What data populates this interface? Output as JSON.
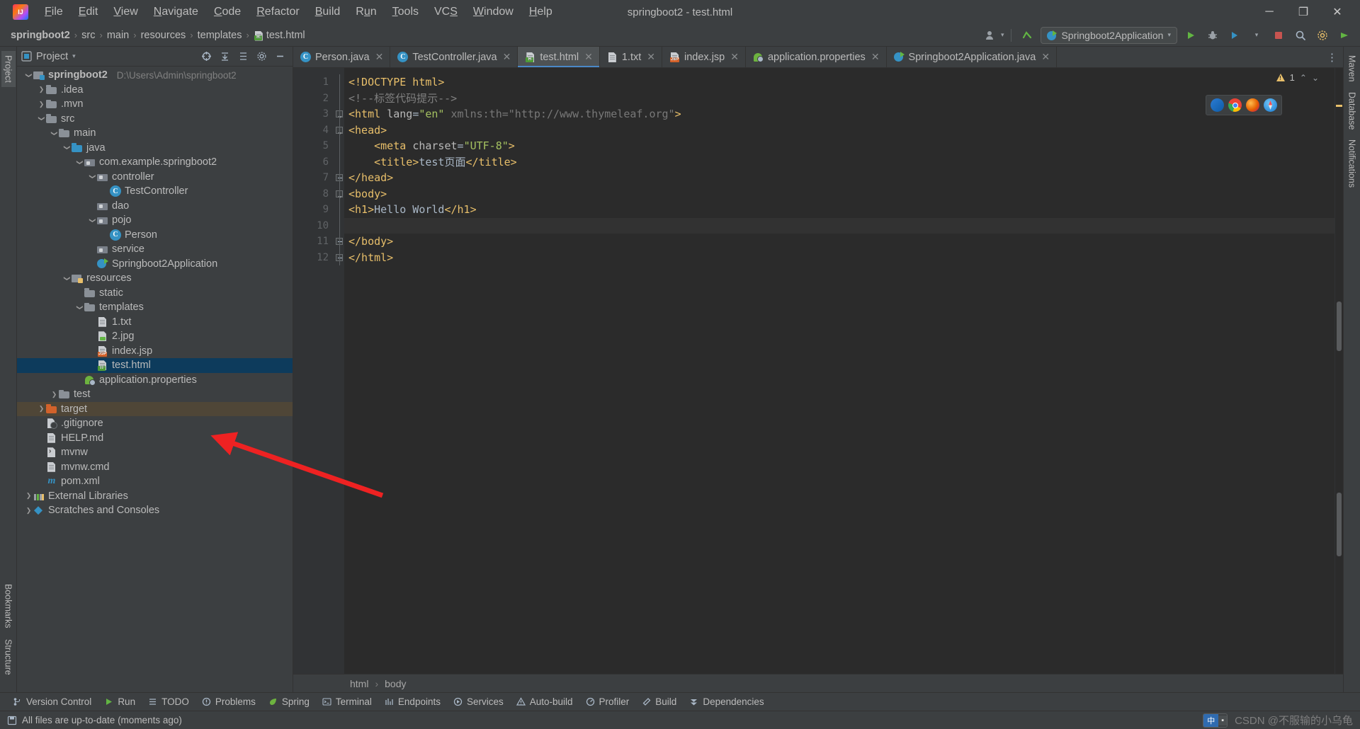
{
  "window": {
    "title": "springboot2 - test.html",
    "minimize_label": "─",
    "maximize_label": "❐",
    "close_label": "✕"
  },
  "menu": {
    "items": [
      {
        "label": "File",
        "mnemonic": "F"
      },
      {
        "label": "Edit",
        "mnemonic": "E"
      },
      {
        "label": "View",
        "mnemonic": "V"
      },
      {
        "label": "Navigate",
        "mnemonic": "N"
      },
      {
        "label": "Code",
        "mnemonic": "C"
      },
      {
        "label": "Refactor",
        "mnemonic": "R"
      },
      {
        "label": "Build",
        "mnemonic": "B"
      },
      {
        "label": "Run",
        "mnemonic": "u"
      },
      {
        "label": "Tools",
        "mnemonic": "T"
      },
      {
        "label": "VCS",
        "mnemonic": "S"
      },
      {
        "label": "Window",
        "mnemonic": "W"
      },
      {
        "label": "Help",
        "mnemonic": "H"
      }
    ]
  },
  "breadcrumb": {
    "separator": "›",
    "items": [
      {
        "label": "springboot2",
        "bold": true,
        "icon": ""
      },
      {
        "label": "src",
        "bold": false,
        "icon": ""
      },
      {
        "label": "main",
        "bold": false,
        "icon": ""
      },
      {
        "label": "resources",
        "bold": false,
        "icon": ""
      },
      {
        "label": "templates",
        "bold": false,
        "icon": ""
      },
      {
        "label": "test.html",
        "bold": false,
        "icon": "html-file-icon"
      }
    ]
  },
  "toolbar": {
    "account_icon": "user-icon",
    "account_chevron": "▾",
    "vcs_updates_icon": "checkmark-arrow-icon",
    "run_config": {
      "label": "Springboot2Application",
      "icon": "spring-boot-icon",
      "chevron": "▾"
    },
    "buttons": [
      {
        "name": "run-button",
        "icon": "run-icon"
      },
      {
        "name": "debug-button",
        "icon": "debug-icon"
      },
      {
        "name": "run-with-coverage-button",
        "icon": "coverage-icon"
      },
      {
        "name": "more-run-options-button",
        "icon": "chevron-down-icon"
      },
      {
        "name": "stop-button",
        "icon": "stop-icon"
      },
      {
        "name": "search-everywhere-button",
        "icon": "search-icon"
      },
      {
        "name": "settings-button",
        "icon": "gear-icon"
      },
      {
        "name": "updates-button",
        "icon": "update-icon"
      }
    ]
  },
  "left_strip": {
    "tabs": [
      {
        "label": "Project",
        "active": true
      },
      {
        "label": "Bookmarks",
        "active": false
      },
      {
        "label": "Structure",
        "active": false
      }
    ]
  },
  "right_strip": {
    "tabs": [
      {
        "label": "Maven",
        "active": false
      },
      {
        "label": "Database",
        "active": false
      },
      {
        "label": "Notifications",
        "active": false
      }
    ]
  },
  "project_panel": {
    "title": "Project",
    "title_chevron": "▾",
    "actions": [
      {
        "name": "select-opened-file-button",
        "icon": "crosshair-icon"
      },
      {
        "name": "expand-all-button",
        "icon": "expand-all-icon"
      },
      {
        "name": "collapse-all-button",
        "icon": "collapse-all-icon"
      },
      {
        "name": "panel-settings-button",
        "icon": "gear-icon"
      },
      {
        "name": "hide-panel-button",
        "icon": "minus-icon"
      }
    ],
    "tree": [
      {
        "label": "springboot2",
        "path": "D:\\Users\\Admin\\springboot2",
        "indent": 0,
        "arrow": "down",
        "icon": "module",
        "bold": true,
        "state": "normal"
      },
      {
        "label": ".idea",
        "path": "",
        "indent": 1,
        "arrow": "right",
        "icon": "folder",
        "bold": false,
        "state": "normal"
      },
      {
        "label": ".mvn",
        "path": "",
        "indent": 1,
        "arrow": "right",
        "icon": "folder",
        "bold": false,
        "state": "normal"
      },
      {
        "label": "src",
        "path": "",
        "indent": 1,
        "arrow": "down",
        "icon": "folder",
        "bold": false,
        "state": "normal"
      },
      {
        "label": "main",
        "path": "",
        "indent": 2,
        "arrow": "down",
        "icon": "folder",
        "bold": false,
        "state": "normal"
      },
      {
        "label": "java",
        "path": "",
        "indent": 3,
        "arrow": "down",
        "icon": "folder-blue",
        "bold": false,
        "state": "normal"
      },
      {
        "label": "com.example.springboot2",
        "path": "",
        "indent": 4,
        "arrow": "down",
        "icon": "package",
        "bold": false,
        "state": "normal"
      },
      {
        "label": "controller",
        "path": "",
        "indent": 5,
        "arrow": "down",
        "icon": "package",
        "bold": false,
        "state": "normal"
      },
      {
        "label": "TestController",
        "path": "",
        "indent": 6,
        "arrow": "none",
        "icon": "class",
        "bold": false,
        "state": "normal"
      },
      {
        "label": "dao",
        "path": "",
        "indent": 5,
        "arrow": "none",
        "icon": "package",
        "bold": false,
        "state": "normal"
      },
      {
        "label": "pojo",
        "path": "",
        "indent": 5,
        "arrow": "down",
        "icon": "package",
        "bold": false,
        "state": "normal"
      },
      {
        "label": "Person",
        "path": "",
        "indent": 6,
        "arrow": "none",
        "icon": "class",
        "bold": false,
        "state": "normal"
      },
      {
        "label": "service",
        "path": "",
        "indent": 5,
        "arrow": "none",
        "icon": "package",
        "bold": false,
        "state": "normal"
      },
      {
        "label": "Springboot2Application",
        "path": "",
        "indent": 5,
        "arrow": "none",
        "icon": "springboot-class",
        "bold": false,
        "state": "normal"
      },
      {
        "label": "resources",
        "path": "",
        "indent": 3,
        "arrow": "down",
        "icon": "resources-folder",
        "bold": false,
        "state": "normal"
      },
      {
        "label": "static",
        "path": "",
        "indent": 4,
        "arrow": "none",
        "icon": "folder",
        "bold": false,
        "state": "normal"
      },
      {
        "label": "templates",
        "path": "",
        "indent": 4,
        "arrow": "down",
        "icon": "folder",
        "bold": false,
        "state": "normal"
      },
      {
        "label": "1.txt",
        "path": "",
        "indent": 5,
        "arrow": "none",
        "icon": "text-file",
        "bold": false,
        "state": "normal"
      },
      {
        "label": "2.jpg",
        "path": "",
        "indent": 5,
        "arrow": "none",
        "icon": "image-file",
        "bold": false,
        "state": "normal"
      },
      {
        "label": "index.jsp",
        "path": "",
        "indent": 5,
        "arrow": "none",
        "icon": "jsp-file",
        "bold": false,
        "state": "normal"
      },
      {
        "label": "test.html",
        "path": "",
        "indent": 5,
        "arrow": "none",
        "icon": "html-file",
        "bold": false,
        "state": "selected"
      },
      {
        "label": "application.properties",
        "path": "",
        "indent": 4,
        "arrow": "none",
        "icon": "spring-properties",
        "bold": false,
        "state": "normal"
      },
      {
        "label": "test",
        "path": "",
        "indent": 2,
        "arrow": "right",
        "icon": "folder",
        "bold": false,
        "state": "normal"
      },
      {
        "label": "target",
        "path": "",
        "indent": 1,
        "arrow": "right",
        "icon": "folder-orange",
        "bold": false,
        "state": "highlight"
      },
      {
        "label": ".gitignore",
        "path": "",
        "indent": 1,
        "arrow": "none",
        "icon": "gitignore-file",
        "bold": false,
        "state": "normal"
      },
      {
        "label": "HELP.md",
        "path": "",
        "indent": 1,
        "arrow": "none",
        "icon": "markdown-file",
        "bold": false,
        "state": "normal"
      },
      {
        "label": "mvnw",
        "path": "",
        "indent": 1,
        "arrow": "none",
        "icon": "mvnw-file",
        "bold": false,
        "state": "normal"
      },
      {
        "label": "mvnw.cmd",
        "path": "",
        "indent": 1,
        "arrow": "none",
        "icon": "text-file",
        "bold": false,
        "state": "normal"
      },
      {
        "label": "pom.xml",
        "path": "",
        "indent": 1,
        "arrow": "none",
        "icon": "maven-file",
        "bold": false,
        "state": "normal"
      },
      {
        "label": "External Libraries",
        "path": "",
        "indent": 0,
        "arrow": "right",
        "icon": "libraries",
        "bold": false,
        "state": "normal"
      },
      {
        "label": "Scratches and Consoles",
        "path": "",
        "indent": 0,
        "arrow": "right",
        "icon": "scratches",
        "bold": false,
        "state": "normal"
      }
    ]
  },
  "editor": {
    "tabs": [
      {
        "label": "Person.java",
        "icon": "java-class-icon",
        "active": false,
        "close": "✕"
      },
      {
        "label": "TestController.java",
        "icon": "java-class-icon",
        "active": false,
        "close": "✕"
      },
      {
        "label": "test.html",
        "icon": "html-file-icon",
        "active": true,
        "close": "✕"
      },
      {
        "label": "1.txt",
        "icon": "text-file-icon",
        "active": false,
        "close": "✕"
      },
      {
        "label": "index.jsp",
        "icon": "jsp-file-icon",
        "active": false,
        "close": "✕"
      },
      {
        "label": "application.properties",
        "icon": "spring-properties-icon",
        "active": false,
        "close": "✕"
      },
      {
        "label": "Springboot2Application.java",
        "icon": "spring-boot-icon",
        "active": false,
        "close": "✕"
      }
    ],
    "tab_overflow_icon": "⋮",
    "inspection": {
      "warning_count": "1",
      "chevron_up": "⌃",
      "chevron_down": "⌄"
    },
    "browser_icons": [
      {
        "name": "edge-browser-icon"
      },
      {
        "name": "chrome-browser-icon"
      },
      {
        "name": "firefox-browser-icon"
      },
      {
        "name": "safari-browser-icon"
      }
    ],
    "line_numbers": [
      "1",
      "2",
      "3",
      "4",
      "5",
      "6",
      "7",
      "8",
      "9",
      "10",
      "11",
      "12"
    ],
    "current_line": 10,
    "lines": [
      {
        "n": 1,
        "tokens": [
          {
            "t": "<!DOCTYPE html>",
            "c": "tag"
          }
        ]
      },
      {
        "n": 2,
        "tokens": [
          {
            "t": "<!--标签代码提示-->",
            "c": "cmt"
          }
        ]
      },
      {
        "n": 3,
        "tokens": [
          {
            "t": "<html ",
            "c": "tag"
          },
          {
            "t": "lang",
            "c": "attr"
          },
          {
            "t": "=",
            "c": "plain"
          },
          {
            "t": "\"en\"",
            "c": "val"
          },
          {
            "t": " xmlns:th=\"http://www.thymeleaf.org\"",
            "c": "dim"
          },
          {
            "t": ">",
            "c": "tag"
          }
        ]
      },
      {
        "n": 4,
        "tokens": [
          {
            "t": "<head>",
            "c": "tag"
          }
        ]
      },
      {
        "n": 5,
        "tokens": [
          {
            "t": "    <meta ",
            "c": "tag"
          },
          {
            "t": "charset",
            "c": "attr"
          },
          {
            "t": "=",
            "c": "plain"
          },
          {
            "t": "\"UTF-8\"",
            "c": "val"
          },
          {
            "t": ">",
            "c": "tag"
          }
        ]
      },
      {
        "n": 6,
        "tokens": [
          {
            "t": "    <title>",
            "c": "tag"
          },
          {
            "t": "test页面",
            "c": "txt"
          },
          {
            "t": "</title>",
            "c": "tag"
          }
        ]
      },
      {
        "n": 7,
        "tokens": [
          {
            "t": "</head>",
            "c": "tag"
          }
        ]
      },
      {
        "n": 8,
        "tokens": [
          {
            "t": "<body>",
            "c": "tag"
          }
        ]
      },
      {
        "n": 9,
        "tokens": [
          {
            "t": "<h1>",
            "c": "tag"
          },
          {
            "t": "Hello World",
            "c": "txt"
          },
          {
            "t": "</h1>",
            "c": "tag"
          }
        ]
      },
      {
        "n": 10,
        "tokens": [
          {
            "t": "",
            "c": "plain"
          }
        ]
      },
      {
        "n": 11,
        "tokens": [
          {
            "t": "</body>",
            "c": "tag"
          }
        ]
      },
      {
        "n": 12,
        "tokens": [
          {
            "t": "</html>",
            "c": "tag"
          }
        ]
      }
    ],
    "breadcrumb": {
      "separator": "›",
      "items": [
        "html",
        "body"
      ]
    }
  },
  "bottom_toolbar": {
    "items": [
      {
        "label": "Version Control",
        "icon": "branch-icon"
      },
      {
        "label": "Run",
        "icon": "run-icon"
      },
      {
        "label": "TODO",
        "icon": "todo-icon"
      },
      {
        "label": "Problems",
        "icon": "problems-icon"
      },
      {
        "label": "Spring",
        "icon": "spring-leaf-icon"
      },
      {
        "label": "Terminal",
        "icon": "terminal-icon"
      },
      {
        "label": "Endpoints",
        "icon": "endpoints-icon"
      },
      {
        "label": "Services",
        "icon": "services-icon"
      },
      {
        "label": "Auto-build",
        "icon": "warning-triangle-icon"
      },
      {
        "label": "Profiler",
        "icon": "profiler-icon"
      },
      {
        "label": "Build",
        "icon": "hammer-icon"
      },
      {
        "label": "Dependencies",
        "icon": "dependencies-icon"
      }
    ]
  },
  "statusbar": {
    "message": "All files are up-to-date (moments ago)",
    "message_icon": "save-indicator-icon",
    "ime": {
      "primary": "中",
      "secondary": "▪"
    },
    "watermark": "CSDN @不服输的小乌龟"
  },
  "colors": {
    "accent_blue": "#4a88c7",
    "selection_blue": "#0d3b5c",
    "target_highlight": "#4f4637",
    "editor_bg": "#2b2b2b",
    "panel_bg": "#3c3f41",
    "gutter_bg": "#313335",
    "annotation_red": "#ee2222",
    "tag_yellow": "#e8bf6a",
    "string_green": "#a5c261",
    "comment_gray": "#808080"
  },
  "annotation": {
    "arrow_name": "red-arrow-annotation",
    "points_to": "test.html"
  }
}
